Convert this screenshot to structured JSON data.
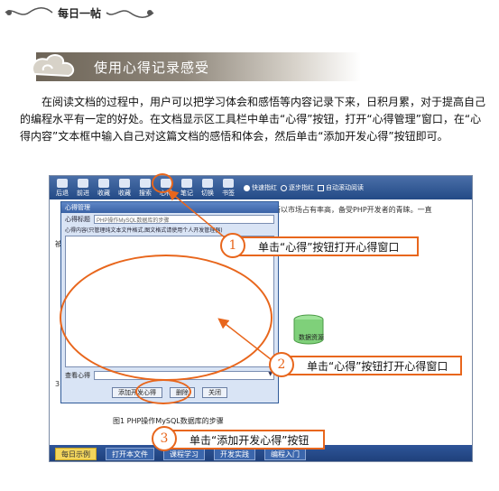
{
  "header": {
    "title": "每日一帖"
  },
  "banner": {
    "title": "使用心得记录感受"
  },
  "paragraph": "在阅读文档的过程中，用户可以把学习体会和感悟等内容记录下来，日积月累，对于提高自己的编程水平有一定的好处。在文档显示区工具栏中单击“心得”按钮，打开“心得管理”窗口，在“心得内容”文本框中输入自己对这篇文档的感悟和体会，然后单击“添加开发心得”按钮即可。",
  "toolbar": {
    "buttons": [
      {
        "label": "后退",
        "icon": "back-arrow-icon"
      },
      {
        "label": "前进",
        "icon": "forward-arrow-icon"
      },
      {
        "label": "收藏",
        "icon": "favorite-icon"
      },
      {
        "label": "收藏",
        "icon": "checkmark-icon"
      },
      {
        "label": "搜索",
        "icon": "search-icon"
      },
      {
        "label": "心得",
        "icon": "notes-icon"
      },
      {
        "label": "笔记",
        "icon": "pencil-icon"
      },
      {
        "label": "切换",
        "icon": "switch-icon"
      },
      {
        "label": "书签",
        "icon": "bookmark-icon"
      }
    ],
    "radios": [
      {
        "label": "快速指红",
        "selected": true
      },
      {
        "label": "逐步指红",
        "selected": false
      }
    ],
    "checkbox_label": "自动滚动阅读"
  },
  "document": {
    "line1": "所以市场占有率高，备受PHP开发者的青睐。一直",
    "line2": "被",
    "side_num": "被",
    "side_num2": "3.",
    "db_label": "数据资源",
    "caption": "图1 PHP操作MySQL数据库的步骤"
  },
  "dialog": {
    "title": "心得管理",
    "subject_label": "心得标题",
    "subject_value": "PHP操作MySQL数据库的步骤",
    "content_note": "心得内容(只管理纯文本文件格式,图文格式请使用个人开发管理器)",
    "view_label": "查看心得",
    "buttons": {
      "add": "添加开发心得",
      "delete": "删除",
      "close": "关闭"
    }
  },
  "statusbar": {
    "buttons": [
      "每日示例",
      "打开本文件",
      "课程学习",
      "开发实践",
      "编程入门"
    ]
  },
  "annotations": [
    {
      "num": "1",
      "text": "单击“心得”按钮打开心得窗口"
    },
    {
      "num": "2",
      "text": "单击“心得”按钮打开心得窗口"
    },
    {
      "num": "3",
      "text": "单击“添加开发心得”按钮"
    }
  ],
  "colors": {
    "accent": "#e8661c",
    "toolbar": "#2c5592",
    "banner": "#7a7265"
  }
}
